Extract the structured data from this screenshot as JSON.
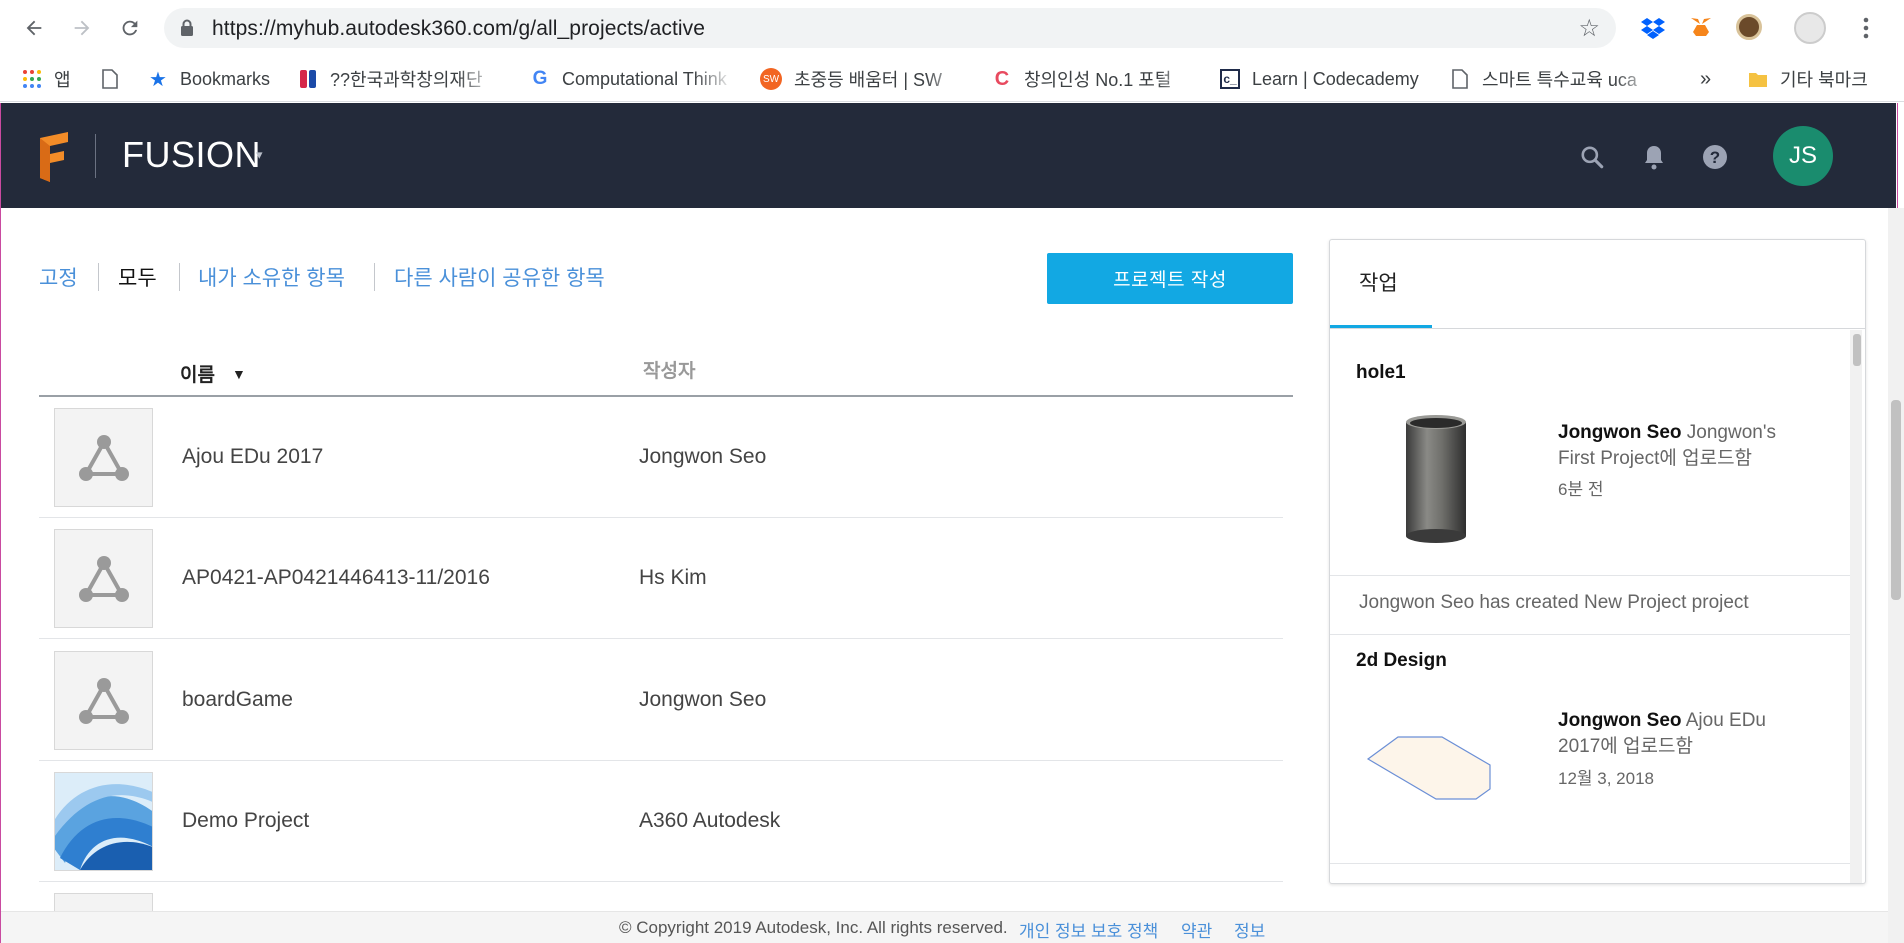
{
  "browser": {
    "url": "https://myhub.autodesk360.com/g/all_projects/active",
    "bookmarks": [
      {
        "label": "앱",
        "icon": "apps-grid-icon"
      },
      {
        "label": "",
        "icon": "page-icon"
      },
      {
        "label": "Bookmarks",
        "icon": "star-icon"
      },
      {
        "label": "??한국과학창의재단",
        "icon": "kofac-icon"
      },
      {
        "label": "Computational Think",
        "icon": "google-icon"
      },
      {
        "label": "초중등 배움터 | SW",
        "icon": "sw-icon"
      },
      {
        "label": "창의인성 No.1 포털",
        "icon": "crezone-icon"
      },
      {
        "label": "Learn | Codecademy",
        "icon": "codecademy-icon"
      },
      {
        "label": "스마트 특수교육 uca",
        "icon": "page-icon"
      }
    ],
    "overflow_label": "»",
    "other_bookmarks_label": "기타 북마크"
  },
  "app": {
    "title": "FUSION",
    "avatar_initials": "JS",
    "brand_color": "#232a3a",
    "accent_color": "#12a8e3"
  },
  "filters": {
    "pinned": "고정",
    "all": "모두",
    "mine": "내가 소유한 항목",
    "shared": "다른 사람이 공유한 항목"
  },
  "create_project_label": "프로젝트 작성",
  "table": {
    "col_name": "이름",
    "col_author": "작성자",
    "rows": [
      {
        "name": "Ajou EDu 2017",
        "author": "Jongwon Seo",
        "thumb": "project-icon"
      },
      {
        "name": "AP0421-AP0421446413-11/2016",
        "author": "Hs Kim",
        "thumb": "project-icon"
      },
      {
        "name": "boardGame",
        "author": "Jongwon Seo",
        "thumb": "project-icon"
      },
      {
        "name": "Demo Project",
        "author": "A360 Autodesk",
        "thumb": "demo-image"
      }
    ]
  },
  "activity": {
    "tab_label": "작업",
    "items": [
      {
        "title": "hole1",
        "user": "Jongwon Seo",
        "action": " Jongwon's First Project에 업로드함",
        "time": "6분 전"
      },
      {
        "message": "Jongwon Seo has created New Project project"
      },
      {
        "title": "2d Design",
        "user": "Jongwon Seo",
        "action": " Ajou EDu 2017에 업로드함",
        "time": "12월 3, 2018"
      }
    ]
  },
  "footer": {
    "copyright": "© Copyright 2019 Autodesk, Inc. All rights reserved.",
    "privacy": "개인 정보 보호 정책",
    "terms": "약관",
    "info": "정보"
  }
}
